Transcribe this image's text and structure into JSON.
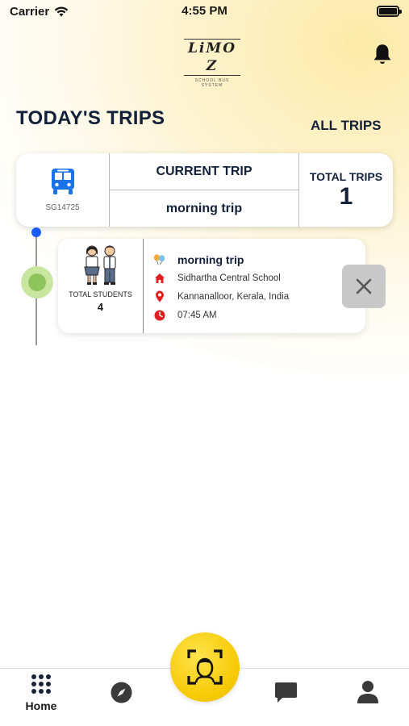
{
  "status_bar": {
    "carrier": "Carrier",
    "time": "4:55 PM"
  },
  "brand": {
    "logo_text": "LiMO Z",
    "logo_tagline": "SCHOOL BUS SYSTEM"
  },
  "header": {
    "title": "TODAY'S TRIPS",
    "all_trips_label": "ALL TRIPS"
  },
  "summary": {
    "bus_id": "SG14725",
    "current_trip_label": "CURRENT TRIP",
    "current_trip_name": "morning trip",
    "total_trips_label": "TOTAL TRIPS",
    "total_trips_value": "1"
  },
  "trip": {
    "students_label": "TOTAL STUDENTS",
    "students_count": "4",
    "name": "morning trip",
    "school": "Sidhartha Central School",
    "location": "Kannanalloor, Kerala, India",
    "time": "07:45 AM"
  },
  "tab_bar": {
    "home_label": "Home"
  },
  "colors": {
    "accent_yellow": "#f5c800",
    "timeline_blue": "#1b5cff",
    "timeline_green": "#8fc45a",
    "icon_red": "#e02020",
    "bus_blue": "#1a73e8"
  }
}
